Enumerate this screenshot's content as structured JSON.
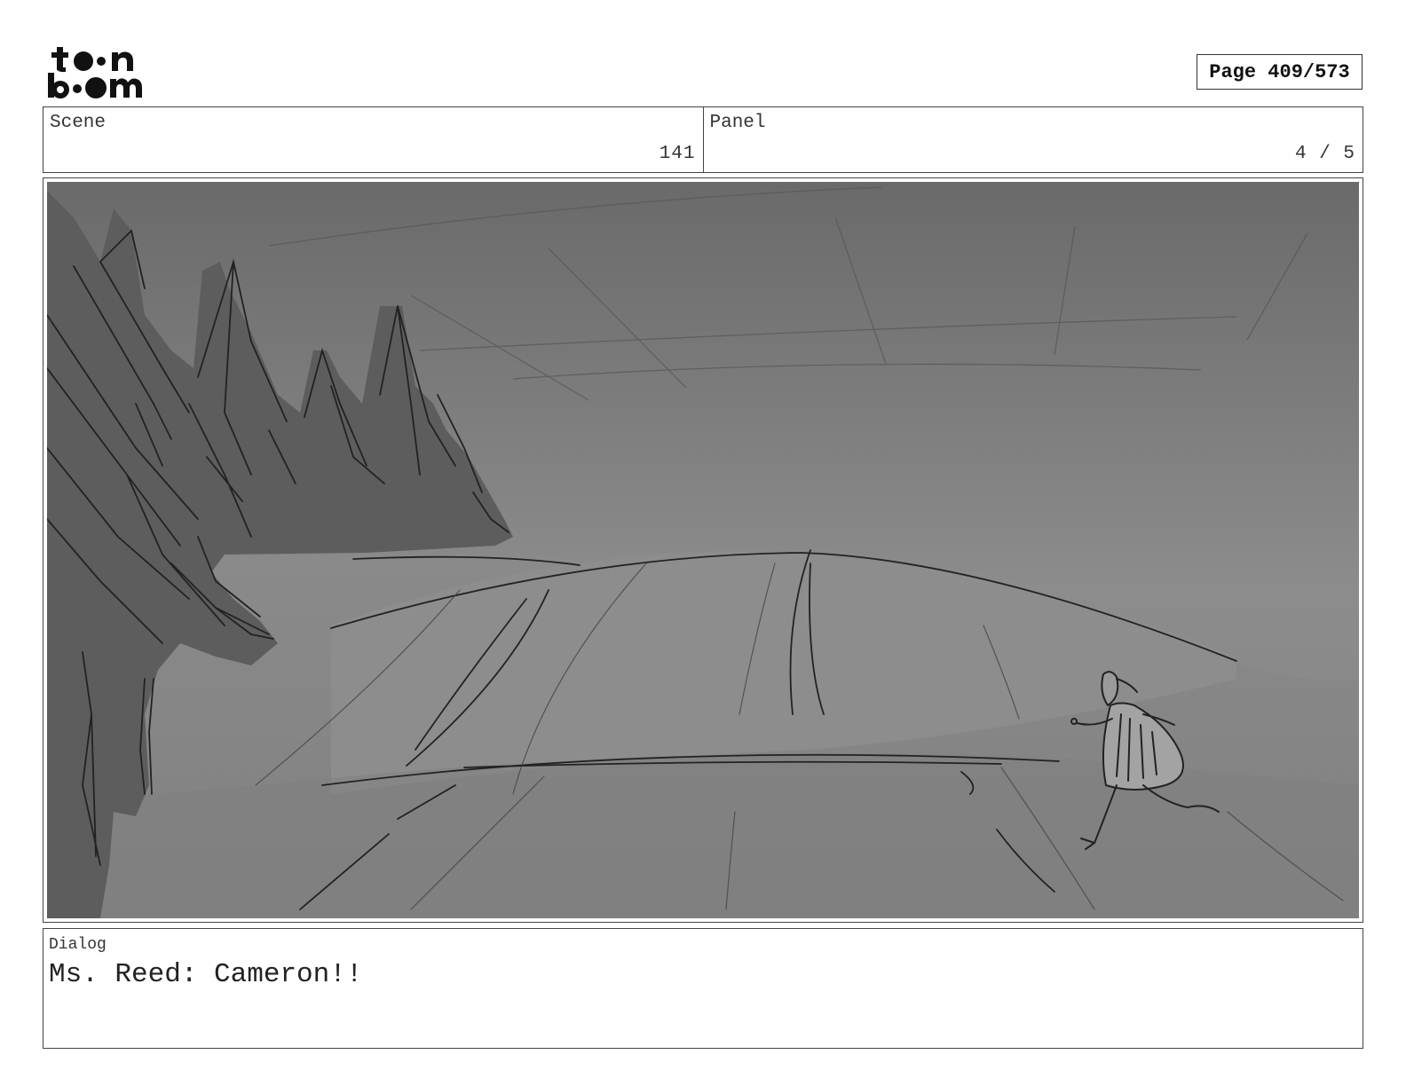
{
  "logo": {
    "text": "toon boom",
    "icon": "toon-boom-logo"
  },
  "page_indicator": "Page 409/573",
  "scene": {
    "label": "Scene",
    "value": "141"
  },
  "panel": {
    "label": "Panel",
    "value": "4 / 5"
  },
  "dialog": {
    "label": "Dialog",
    "text": "Ms. Reed: Cameron!!"
  }
}
